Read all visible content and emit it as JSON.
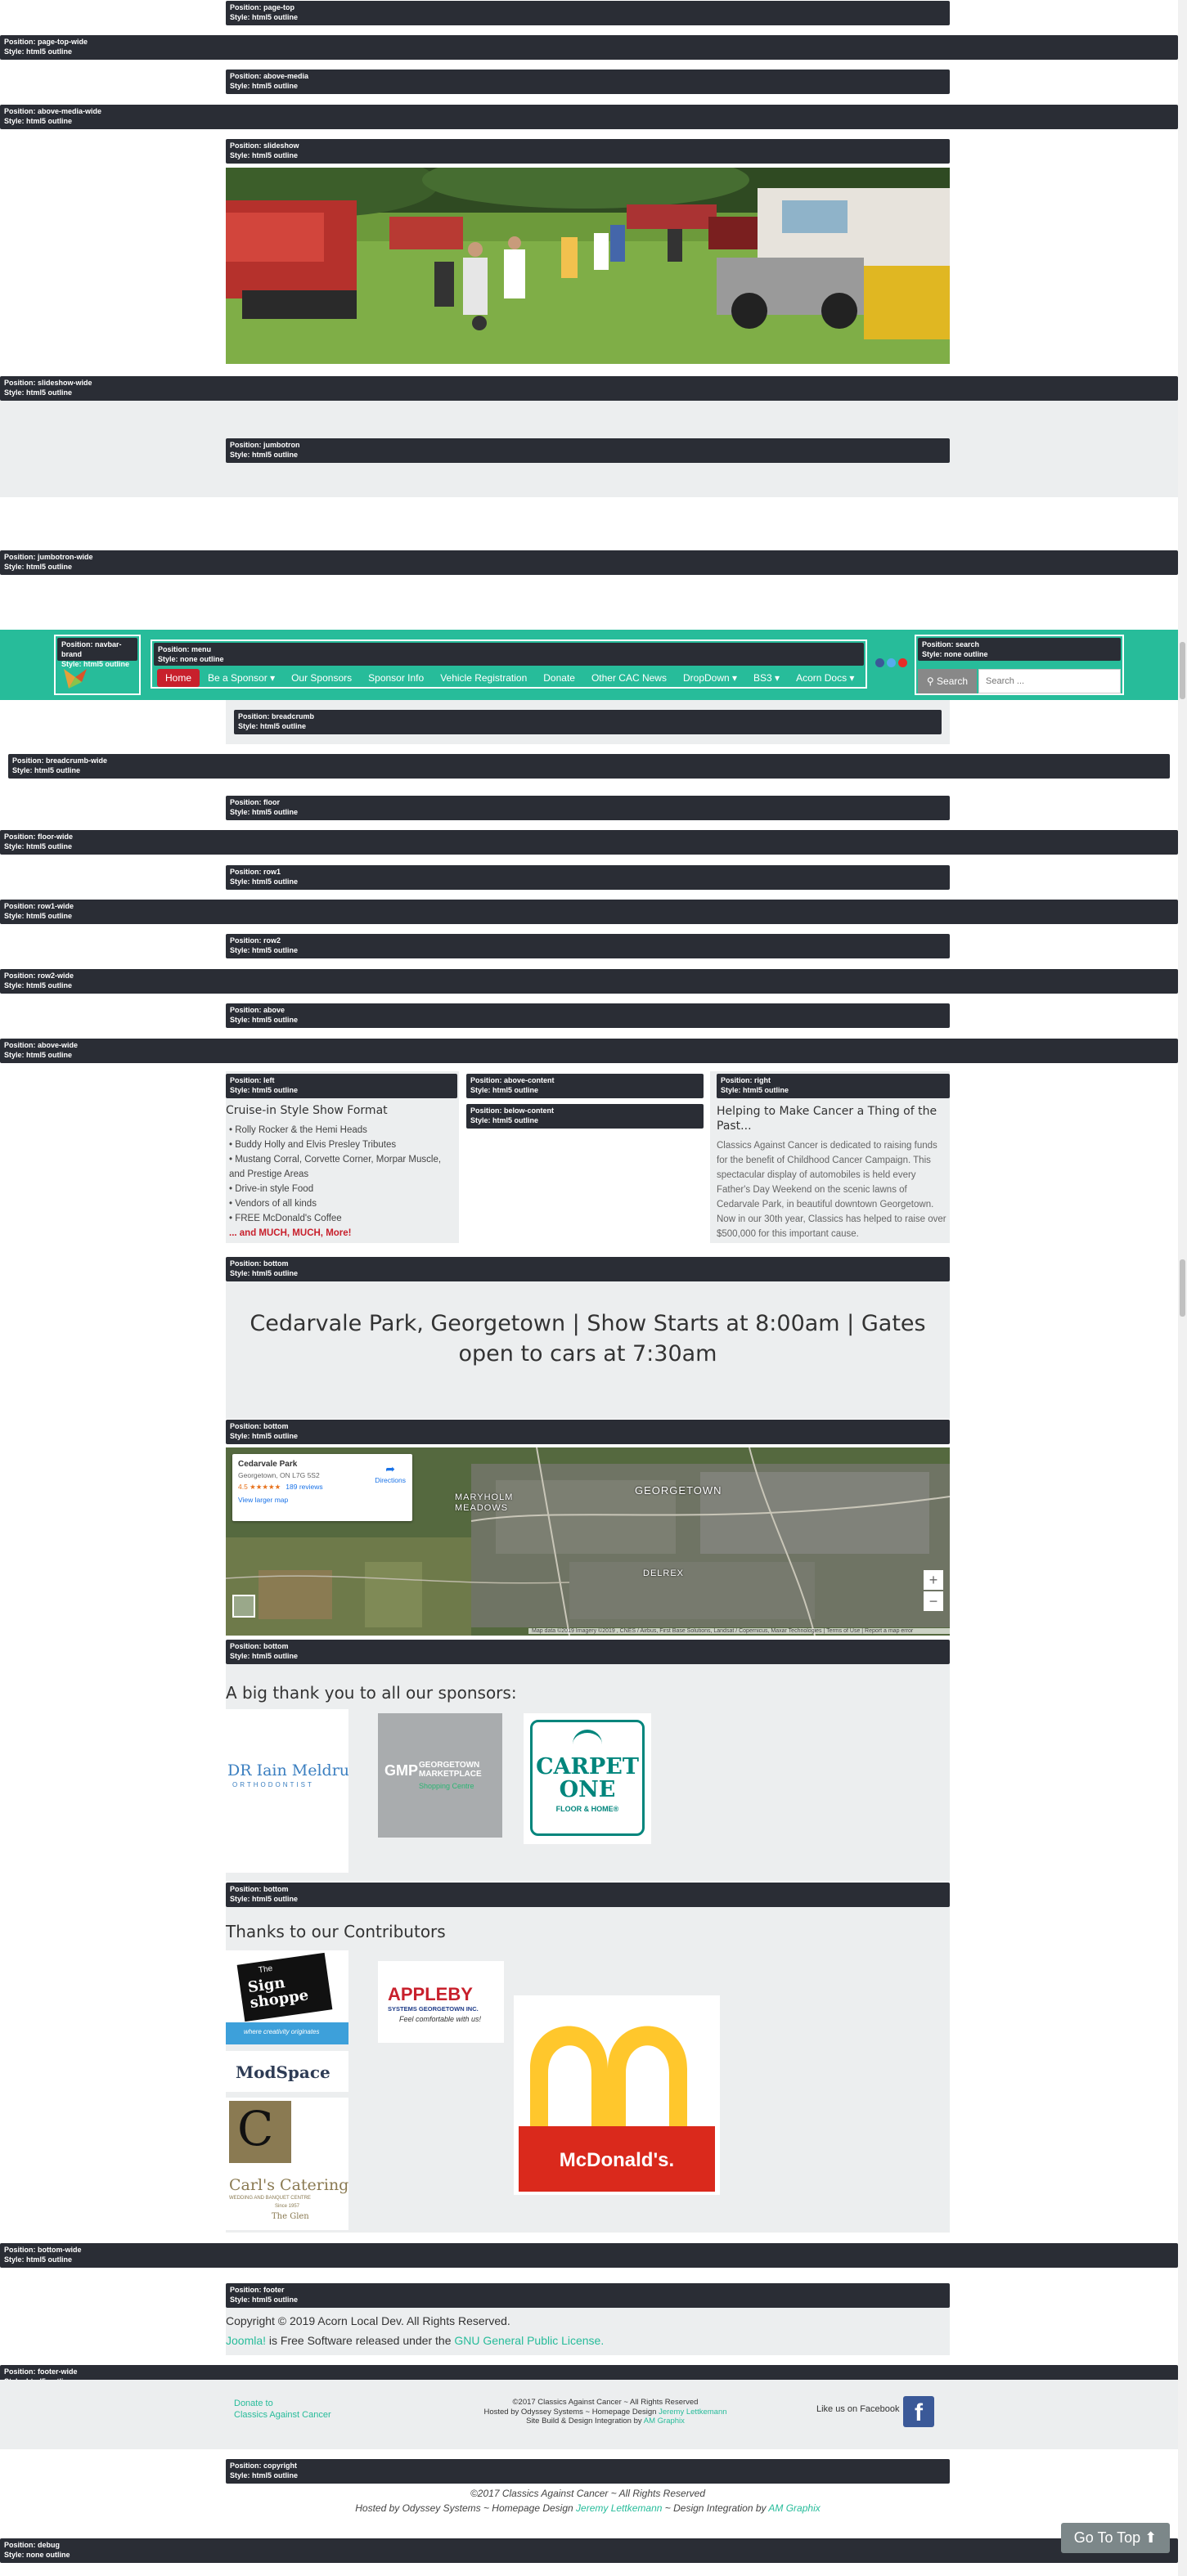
{
  "labels": {
    "position_prefix": "Position:",
    "style_prefix": "Style:"
  },
  "positions": [
    {
      "name": "page-top",
      "style": "html5 outline"
    },
    {
      "name": "page-top-wide",
      "style": "html5 outline"
    },
    {
      "name": "above-media",
      "style": "html5 outline"
    },
    {
      "name": "above-media-wide",
      "style": "html5 outline"
    },
    {
      "name": "slideshow",
      "style": "html5 outline"
    },
    {
      "name": "slideshow-wide",
      "style": "html5 outline"
    },
    {
      "name": "jumbotron",
      "style": "html5 outline"
    },
    {
      "name": "jumbotron-wide",
      "style": "html5 outline"
    },
    {
      "name": "navbar-brand",
      "style": "html5 outline"
    },
    {
      "name": "menu",
      "style": "none outline"
    },
    {
      "name": "search",
      "style": "none outline"
    },
    {
      "name": "breadcrumb",
      "style": "html5 outline"
    },
    {
      "name": "breadcrumb-wide",
      "style": "html5 outline"
    },
    {
      "name": "floor",
      "style": "html5 outline"
    },
    {
      "name": "floor-wide",
      "style": "html5 outline"
    },
    {
      "name": "row1",
      "style": "html5 outline"
    },
    {
      "name": "row1-wide",
      "style": "html5 outline"
    },
    {
      "name": "row2",
      "style": "html5 outline"
    },
    {
      "name": "row2-wide",
      "style": "html5 outline"
    },
    {
      "name": "above",
      "style": "html5 outline"
    },
    {
      "name": "above-wide",
      "style": "html5 outline"
    },
    {
      "name": "left",
      "style": "html5 outline"
    },
    {
      "name": "above-content",
      "style": "html5 outline"
    },
    {
      "name": "below-content",
      "style": "html5 outline"
    },
    {
      "name": "right",
      "style": "html5 outline"
    },
    {
      "name": "bottom",
      "style": "html5 outline"
    },
    {
      "name": "bottom",
      "style": "html5 outline"
    },
    {
      "name": "bottom",
      "style": "html5 outline"
    },
    {
      "name": "bottom",
      "style": "html5 outline"
    },
    {
      "name": "bottom-wide",
      "style": "html5 outline"
    },
    {
      "name": "footer",
      "style": "html5 outline"
    },
    {
      "name": "footer-wide",
      "style": "html5 outline"
    },
    {
      "name": "copyright",
      "style": "html5 outline"
    },
    {
      "name": "debug",
      "style": "none outline"
    }
  ],
  "menu": {
    "items": [
      "Home",
      "Be a Sponsor ▾",
      "Our Sponsors",
      "Sponsor Info",
      "Vehicle Registration",
      "Donate",
      "Other CAC News",
      "DropDown ▾",
      "BS3 ▾",
      "Acorn Docs ▾"
    ],
    "active_index": 0
  },
  "search": {
    "button": "Search",
    "placeholder": "Search ..."
  },
  "left_col": {
    "title": "Cruise-in Style Show Format",
    "items": [
      "• Rolly Rocker & the Hemi Heads",
      "• Buddy Holly and Elvis Presley Tributes",
      "• Mustang Corral, Corvette Corner, Morpar Muscle, and Prestige Areas",
      "• Drive-in style Food",
      "• Vendors of all kinds",
      "• FREE McDonald's Coffee"
    ],
    "more": "... and MUCH, MUCH, More!"
  },
  "right_col": {
    "title": "Helping to Make Cancer a Thing of the Past...",
    "text": "Classics Against Cancer is dedicated to raising funds for the benefit of Childhood Cancer Campaign. This spectacular display of automobiles is held every Father's Day Weekend on the scenic lawns of Cedarvale Park, in beautiful downtown Georgetown. Now in our 30th year, Classics has helped to raise over $500,000 for this important cause."
  },
  "headline": "Cedarvale Park, Georgetown | Show Starts at 8:00am | Gates open to cars at 7:30am",
  "map": {
    "place": "Cedarvale Park",
    "address": "Georgetown, ON L7G 5S2",
    "rating": "4.5 ★★★★★",
    "reviews": "189 reviews",
    "larger": "View larger map",
    "directions": "Directions",
    "labels": [
      "MARYHOLM MEADOWS",
      "GEORGETOWN",
      "DELREX"
    ],
    "attribution": "Map data ©2019 Imagery ©2019 , CNES / Airbus, First Base Solutions, Landsat / Copernicus, Maxar Technologies | Terms of Use | Report a map error"
  },
  "sponsors": {
    "title": "A big thank you to all our sponsors:",
    "meldrum_name": "DR Iain Meldrum",
    "meldrum_sub": "ORTHODONTIST",
    "gmp_mark": "GMP",
    "gmp_name": "GEORGETOWN MARKETPLACE",
    "gmp_sub": "Shopping Centre",
    "carpet_name": "CARPET ONE",
    "carpet_sub": "FLOOR & HOME®"
  },
  "contributors": {
    "title": "Thanks to our Contributors",
    "sign_top": "The",
    "sign_name": "Sign shoppe",
    "sign_tag": "where creativity originates",
    "appleby_name": "APPLEBY",
    "appleby_sub": "SYSTEMS GEORGETOWN INC.",
    "appleby_tag": "Feel comfortable with us!",
    "modspace": "ModSpace",
    "carls_mark": "C",
    "carls_name": "Carl's Catering",
    "carls_sub": "WEDDING AND BANQUET CENTRE",
    "carls_since": "Since 1957",
    "carls_glen": "The Glen",
    "mcd_name": "McDonald's."
  },
  "footer": {
    "copyright": "Copyright © 2019 Acorn Local Dev. All Rights Reserved.",
    "joomla": "Joomla!",
    "joomla_rest": " is Free Software released under the ",
    "gpl": "GNU General Public License."
  },
  "footer_wide": {
    "donate1": "Donate to",
    "donate2": "Classics Against Cancer",
    "line1": "©2017 Classics Against Cancer ~ All Rights Reserved",
    "line2a": "Hosted by Odyssey Systems ~ Homepage Design ",
    "line2b": "Jeremy Lettkemann",
    "line3a": "Site Build & Design Integration by ",
    "line3b": "AM Graphix",
    "facebook": "Like us on Facebook",
    "fb_glyph": "f"
  },
  "copyright": {
    "line1": "©2017 Classics Against Cancer ~ All Rights Reserved",
    "line2a": "Hosted by Odyssey Systems ~ Homepage Design ",
    "line2b": "Jeremy Lettkemann",
    "line2c": " ~ Design Integration by ",
    "line2d": "AM Graphix"
  },
  "gotop": "Go To Top ⬆",
  "colors": {
    "accent": "#27bc9a",
    "dark": "#2a2d35",
    "red": "#c8202c",
    "grey": "#eceeef"
  }
}
